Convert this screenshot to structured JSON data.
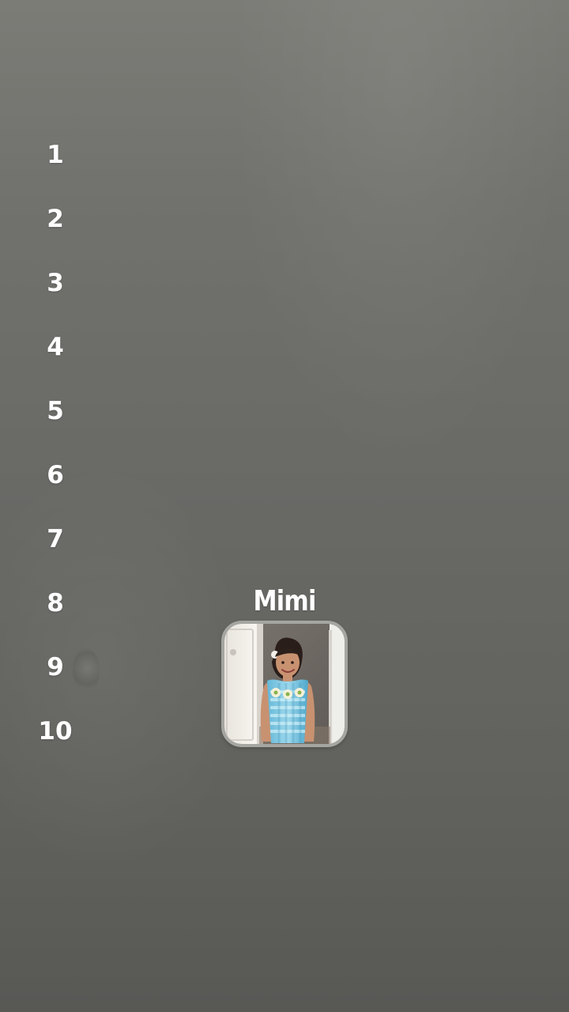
{
  "ranking": {
    "items": [
      {
        "label": "1"
      },
      {
        "label": "2"
      },
      {
        "label": "3"
      },
      {
        "label": "4"
      },
      {
        "label": "5"
      },
      {
        "label": "6"
      },
      {
        "label": "7"
      },
      {
        "label": "8"
      },
      {
        "label": "9"
      },
      {
        "label": "10"
      }
    ]
  },
  "active_item": {
    "name": "Mimi",
    "image": "child-photo"
  },
  "colors": {
    "background": "#696966",
    "text": "#ffffff",
    "card_border": "#a5a5a1"
  }
}
